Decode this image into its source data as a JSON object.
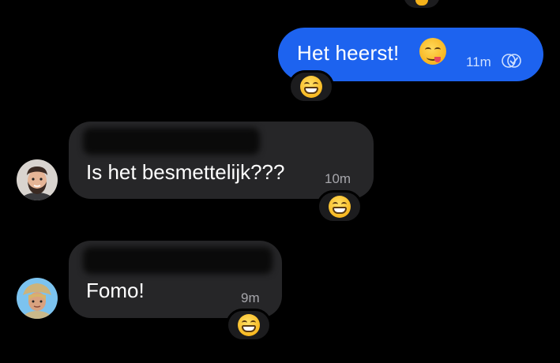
{
  "messages": [
    {
      "direction": "outgoing",
      "text": "Het heerst!",
      "emoji": "yum-face",
      "time": "11m",
      "status_icon": "read-receipt-icon",
      "reaction": "grinning-face"
    },
    {
      "direction": "incoming",
      "sender_name_hidden": true,
      "avatar": "man-with-beard-avatar",
      "text": "Is het besmettelijk???",
      "time": "10m",
      "reaction": "grinning-face"
    },
    {
      "direction": "incoming",
      "sender_name_hidden": true,
      "avatar": "woman-with-hat-avatar",
      "text": "Fomo!",
      "time": "9m",
      "reaction": "grinning-face"
    }
  ],
  "colors": {
    "background": "#000000",
    "outgoing_bubble": "#1d63ef",
    "incoming_bubble": "#262628",
    "reaction_pill": "#1c1c1e"
  }
}
